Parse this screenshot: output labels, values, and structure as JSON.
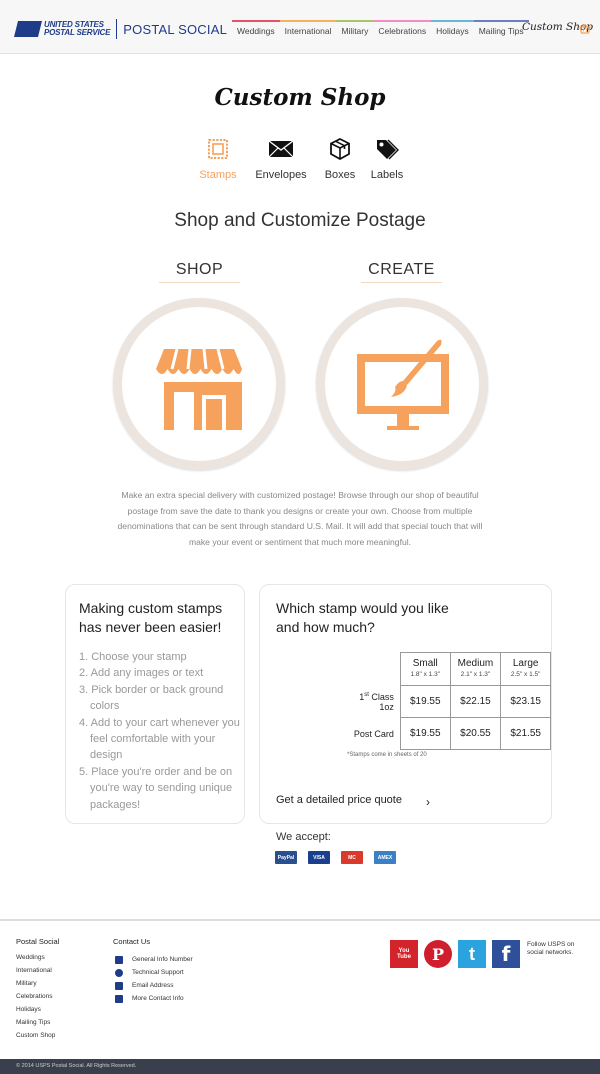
{
  "header": {
    "logo_line1": "UNITED STATES",
    "logo_line2": "POSTAL SERVICE",
    "brand": "POSTAL SOCIAL",
    "nav": [
      {
        "label": "Weddings",
        "color": "#e0556b"
      },
      {
        "label": "International",
        "color": "#f3b35c"
      },
      {
        "label": "Military",
        "color": "#a9c56b"
      },
      {
        "label": "Celebrations",
        "color": "#f28ec0"
      },
      {
        "label": "Holidays",
        "color": "#68b9d9"
      },
      {
        "label": "Mailing Tips",
        "color": "#6d7fc4"
      }
    ],
    "custom_shop": "Custom Shop",
    "basket_icon": "basket-icon"
  },
  "page_title": "Custom Shop",
  "tabs": [
    {
      "label": "Stamps",
      "icon": "stamp-icon",
      "active": true
    },
    {
      "label": "Envelopes",
      "icon": "envelope-icon",
      "active": false
    },
    {
      "label": "Boxes",
      "icon": "box-icon",
      "active": false
    },
    {
      "label": "Labels",
      "icon": "tag-icon",
      "active": false
    }
  ],
  "subtitle": "Shop and Customize Postage",
  "shop": {
    "label": "SHOP",
    "icon": "storefront-icon"
  },
  "create": {
    "label": "CREATE",
    "icon": "monitor-brush-icon"
  },
  "description": "Make an extra special delivery with customized postage! Browse through our shop of beautiful postage from save the date to thank you designs or create your own. Choose from multiple denominations that can be sent through standard U.S. Mail. It will add that special touch that will make your event or sentiment that much more meaningful.",
  "steps_card": {
    "heading": "Making custom stamps has never been easier!",
    "steps": [
      "1. Choose your stamp",
      "2. Add any images or text",
      "3. Pick border or back ground colors",
      "4. Add to your cart whenever you feel comfortable with your design",
      "5. Place you're order and be on  you're way to sending unique packages!"
    ]
  },
  "price_card": {
    "heading": "Which stamp would you like and how much?",
    "sizes": [
      {
        "name": "Small",
        "dims": "1.8\" x 1.3\""
      },
      {
        "name": "Medium",
        "dims": "2.1\" x 1.3\""
      },
      {
        "name": "Large",
        "dims": "2.5\" x 1.5\""
      }
    ],
    "rows": [
      {
        "label_main": "1",
        "label_sup": "st",
        "label_rest": " Class 1oz",
        "prices": [
          "$19.55",
          "$22.15",
          "$23.15"
        ]
      },
      {
        "label_main": "Post Card",
        "label_sup": "",
        "label_rest": "",
        "prices": [
          "$19.55",
          "$20.55",
          "$21.55"
        ]
      }
    ],
    "footnote": "*Stamps come in sheets of 20",
    "quote_link": "Get a detailed price quote",
    "chevron": "›"
  },
  "accept": {
    "label": "We accept:",
    "cards": [
      {
        "name": "PayPal",
        "color": "#2a4f8f"
      },
      {
        "name": "VISA",
        "color": "#1a3f8f"
      },
      {
        "name": "MC",
        "color": "#d93a2b"
      },
      {
        "name": "AMEX",
        "color": "#3b7fc4"
      }
    ]
  },
  "footer": {
    "col1_title": "Postal Social",
    "col1_links": [
      "Weddings",
      "International",
      "Military",
      "Celebrations",
      "Holidays",
      "Mailing Tips",
      "Custom Shop"
    ],
    "col2_title": "Contact Us",
    "col2_links": [
      {
        "label": "General Info Number",
        "icon": "phone-icon"
      },
      {
        "label": "Technical Support",
        "icon": "gear-icon"
      },
      {
        "label": "Email Address",
        "icon": "mail-icon"
      },
      {
        "label": "More Contact Info",
        "icon": "contact-icon"
      }
    ],
    "social": [
      {
        "name": "YouTube",
        "glyph": "You\nTube",
        "color": "#d3232b"
      },
      {
        "name": "Pinterest",
        "glyph": "P",
        "color": "#d01f2c"
      },
      {
        "name": "Twitter",
        "glyph": "t",
        "color": "#2aa3df"
      },
      {
        "name": "Facebook",
        "glyph": "f",
        "color": "#2e4f9a"
      }
    ],
    "follow": "Follow USPS on social networks.",
    "copyright": "© 2014 USPS Postal Social. All Rights Reserved."
  },
  "colors": {
    "accent": "#f7a25c",
    "ring": "#ece5df",
    "footer_bar": "#3a3f4d"
  }
}
